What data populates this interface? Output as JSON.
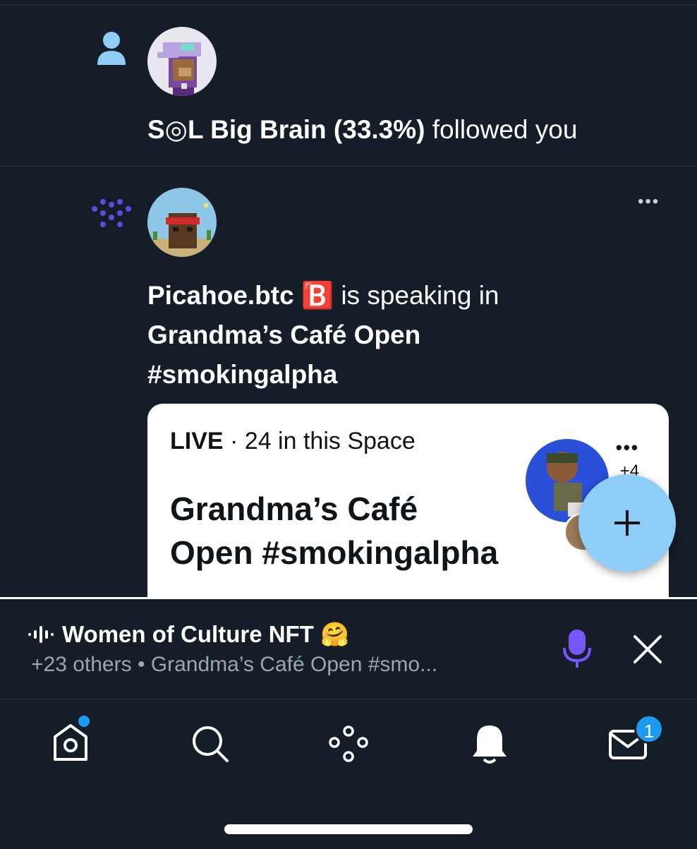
{
  "notifications": [
    {
      "type": "follow",
      "icon": "person-icon",
      "name": "S◎L Big Brain (33.3%)",
      "action": " followed you"
    },
    {
      "type": "space-speaking",
      "icon": "spaces-dots-icon",
      "name": "Picahoe.btc",
      "emoji": "🅱️",
      "action": " is speaking in",
      "space_title_line1": "Grandma’s Café Open",
      "space_title_line2": "#smokingalpha",
      "more_label": "•••"
    }
  ],
  "space_card": {
    "live_label": "LIVE",
    "listeners": " · 24 in this Space",
    "title": "Grandma’s Café Open #smokingalpha",
    "more": "•••",
    "extra_count": "+4"
  },
  "dock": {
    "title": "Women of Culture NFT 🤗",
    "subtitle": "+23 others • Grandma’s Café Open #smo..."
  },
  "tabbar": {
    "items": [
      "home",
      "search",
      "spaces",
      "notifications",
      "messages"
    ],
    "messages_badge": "1"
  },
  "colors": {
    "background": "#151d28",
    "accent_blue": "#1d9bf0",
    "fab": "#8ecdf8",
    "mic": "#7856ff"
  }
}
